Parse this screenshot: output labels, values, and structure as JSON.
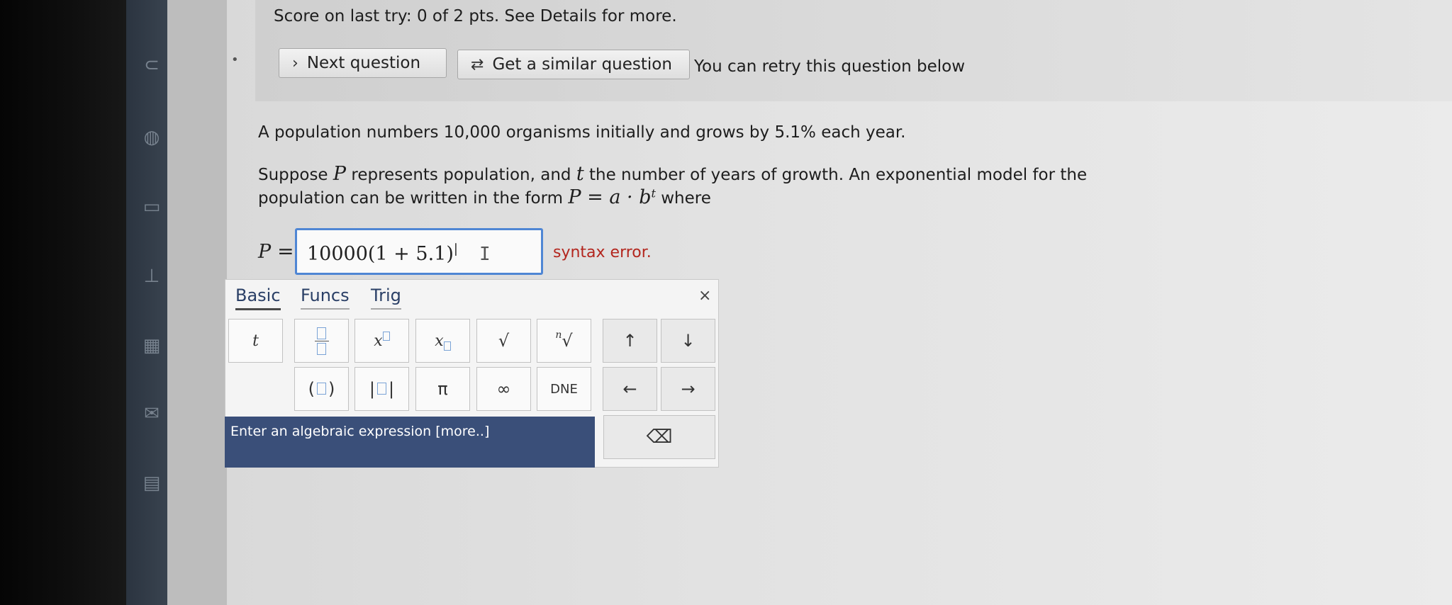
{
  "score_line": "Score on last try: 0 of 2 pts. See Details for more.",
  "buttons": {
    "next_question": "Next question",
    "next_icon": "›",
    "similar_question": "Get a similar question",
    "similar_icon": "⇄"
  },
  "retry_text": "You can retry this question below",
  "question": {
    "line1": "A population numbers 10,000 organisms initially and grows by 5.1% each year.",
    "line2_a": "Suppose ",
    "var_P": "P",
    "line2_b": " represents population, and ",
    "var_t": "t",
    "line2_c": " the number of years of growth. An exponential model for the",
    "line3_a": "population can be written in the form ",
    "formula": "P = a · b",
    "formula_exp": "t",
    "line3_b": " where"
  },
  "answer": {
    "label_var": "P",
    "label_eq": " =",
    "value": "10000(1 + 5.1)",
    "error": "syntax error."
  },
  "keyboard": {
    "tabs": [
      "Basic",
      "Funcs",
      "Trig"
    ],
    "close": "×",
    "keys": {
      "t": "t",
      "x_power": "x",
      "x_sub": "x",
      "sqrt": "√",
      "nth_root_n": "n",
      "nth_root": "√",
      "up": "↑",
      "down": "↓",
      "pi": "π",
      "infinity": "∞",
      "dne": "DNE",
      "left": "←",
      "right": "→",
      "backspace": "⌫"
    },
    "hint": "Enter an algebraic expression [more..]"
  }
}
